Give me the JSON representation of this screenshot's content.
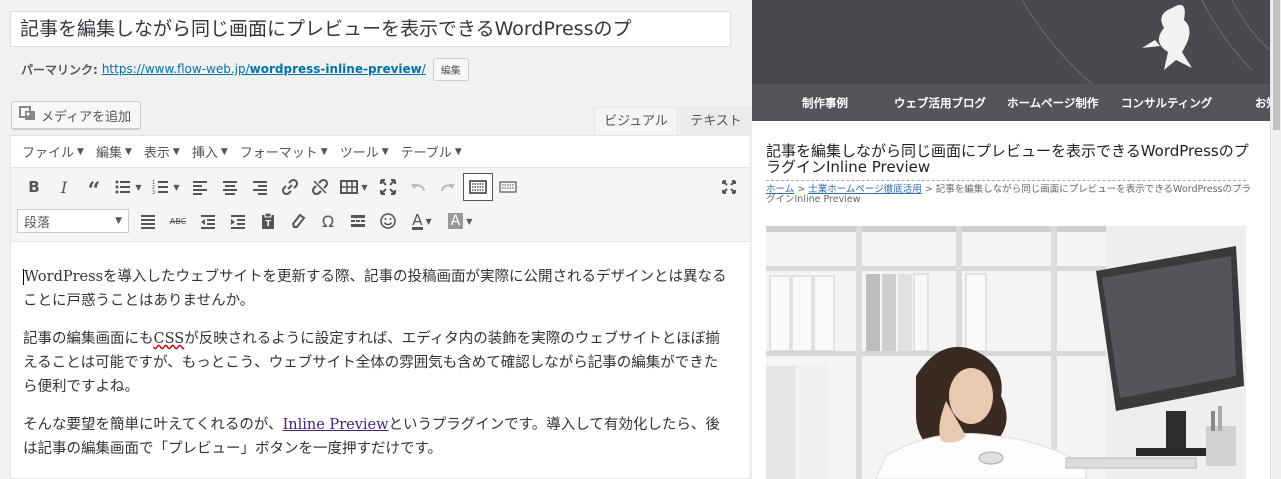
{
  "editor": {
    "post_title": "記事を編集しながら同じ画面にプレビューを表示できるWordPressのプ",
    "permalink": {
      "label": "パーマリンク:",
      "url_prefix": "https://www.flow-web.jp/",
      "url_slug": "wordpress-inline-preview",
      "url_suffix": "/",
      "edit_label": "編集"
    },
    "add_media_label": "メディアを追加",
    "tabs": {
      "visual": "ビジュアル",
      "text": "テキスト"
    },
    "menu": [
      "ファイル",
      "編集",
      "表示",
      "挿入",
      "フォーマット",
      "ツール",
      "テーブル"
    ],
    "format_select": "段落",
    "content": {
      "p1": "WordPressを導入したウェブサイトを更新する際、記事の投稿画面が実際に公開されるデザインとは異なることに戸惑うことはありませんか。",
      "p2_before": "記事の編集画面にも",
      "p2_css": "CSS",
      "p2_after": "が反映されるように設定すれば、エディタ内の装飾を実際のウェブサイトとほぼ揃えることは可能ですが、もっとこう、ウェブサイト全体の雰囲気も含めて確認しながら記事の編集ができたら便利ですよね。",
      "p3_before": "そんな要望を簡単に叶えてくれるのが、",
      "p3_link": "Inline Preview",
      "p3_after": "というプラグインです。導入して有効化したら、後は記事の編集画面で「プレビュー」ボタンを一度押すだけです。"
    }
  },
  "preview": {
    "nav": [
      "制作事例",
      "ウェブ活用ブログ",
      "ホームページ制作",
      "コンサルティング",
      "お知"
    ],
    "post_title": "記事を編集しながら同じ画面にプレビューを表示できるWordPressのプラグインInline Preview",
    "breadcrumb": {
      "home": "ホーム",
      "sep": " > ",
      "category": "士業ホームページ徹底活用",
      "current": "記事を編集しながら同じ画面にプレビューを表示できるWordPressのプラグインInline Preview"
    }
  },
  "colors": {
    "link": "#0073aa",
    "header_bg": "#4a4950",
    "nav_bg": "#55545b"
  }
}
